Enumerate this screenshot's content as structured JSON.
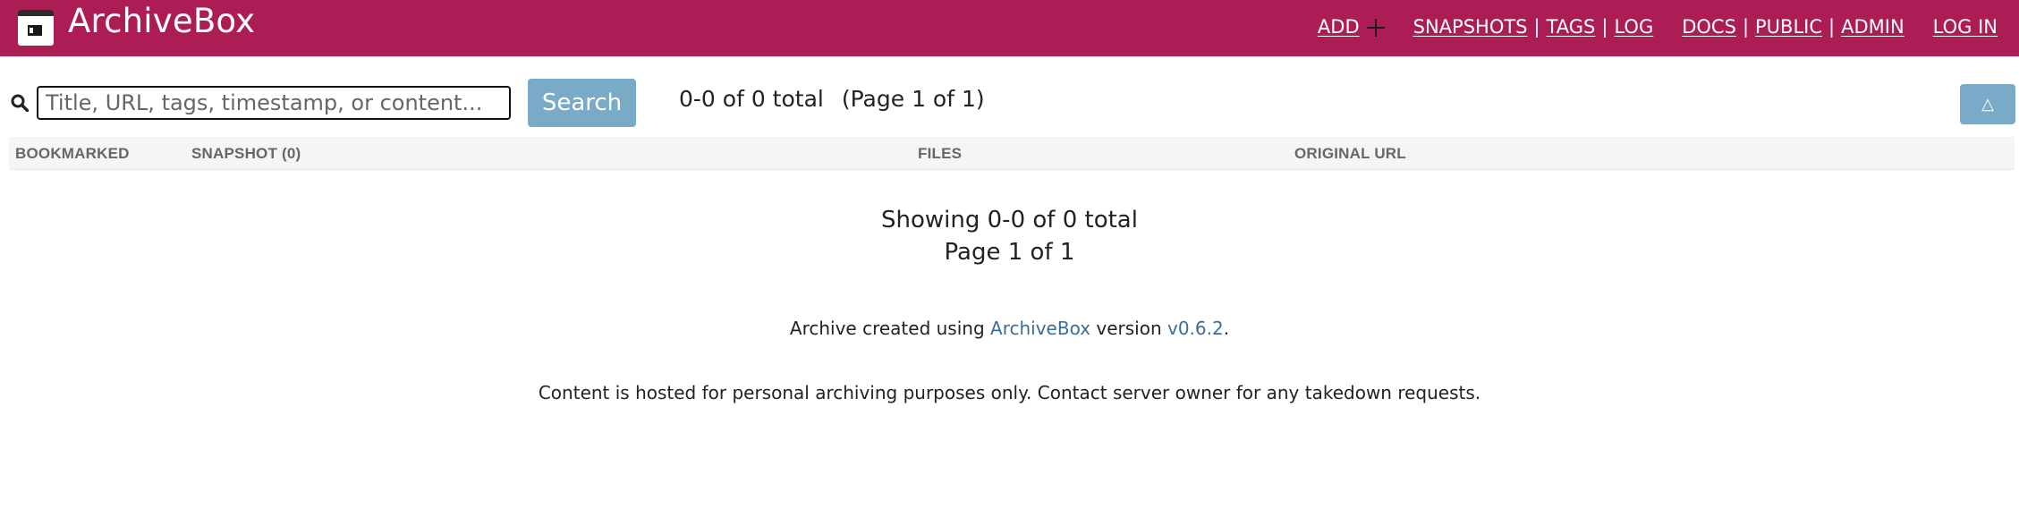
{
  "header": {
    "brand": "ArchiveBox",
    "nav": {
      "add": "ADD",
      "snapshots": "SNAPSHOTS",
      "tags": "TAGS",
      "log": "LOG",
      "docs": "DOCS",
      "public": "PUBLIC",
      "admin": "ADMIN",
      "login": "LOG IN",
      "separator": "|"
    },
    "background_color": "#ac1d55"
  },
  "toolbar": {
    "search_icon": "search-icon",
    "search_placeholder": "Title, URL, tags, timestamp, or content...",
    "search_value": "",
    "search_button": "Search",
    "results_total": "0-0 of 0 total",
    "results_page": "(Page 1 of 1)",
    "scroll_top_icon": "triangle-up-icon",
    "scroll_top_symbol": "△",
    "button_color": "#79aac8"
  },
  "table": {
    "columns": [
      "BOOKMARKED",
      "SNAPSHOT (0)",
      "FILES",
      "ORIGINAL URL"
    ],
    "rows": []
  },
  "empty_state": {
    "line1": "Showing 0-0 of 0 total",
    "line2": "Page 1 of 1"
  },
  "footer": {
    "created_prefix": "Archive created using ",
    "created_link": "ArchiveBox",
    "created_middle": " version ",
    "version": "v0.6.2",
    "created_suffix": ".",
    "disclaimer": "Content is hosted for personal archiving purposes only. Contact server owner for any takedown requests.",
    "link_color": "#3b6d99"
  }
}
